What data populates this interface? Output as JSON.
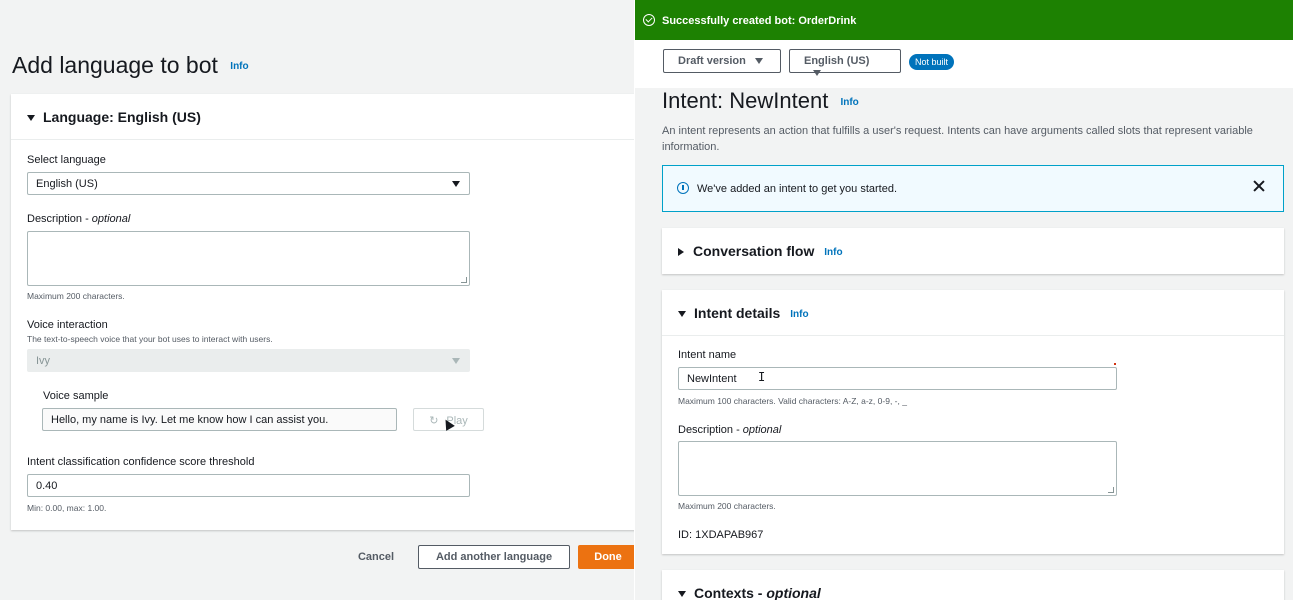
{
  "left": {
    "title": "Add language to bot",
    "title_info": "Info",
    "card_header": "Language: English (US)",
    "select_language_label": "Select language",
    "select_language_value": "English (US)",
    "description_label": "Description - ",
    "description_optional": "optional",
    "description_hint": "Maximum 200 characters.",
    "voice_label": "Voice interaction",
    "voice_hint": "The text-to-speech voice that your bot uses to interact with users.",
    "voice_value": "Ivy",
    "voice_sample_label": "Voice sample",
    "voice_sample_value": "Hello, my name is Ivy. Let me know how I can assist you.",
    "play_label": "Play",
    "threshold_label": "Intent classification confidence score threshold",
    "threshold_value": "0.40",
    "threshold_hint": "Min: 0.00, max: 1.00.",
    "cancel": "Cancel",
    "add_another": "Add another language",
    "done": "Done"
  },
  "right": {
    "flash": "Successfully created bot: OrderDrink",
    "version_dropdown": "Draft version",
    "language_dropdown": "English (US)",
    "status_badge": "Not built",
    "title": "Intent: NewIntent",
    "title_info": "Info",
    "description": "An intent represents an action that fulfills a user's request. Intents can have arguments called slots that represent variable information.",
    "alert": "We've added an intent to get you started.",
    "conversation_flow": "Conversation flow",
    "conversation_info": "Info",
    "intent_details": "Intent details",
    "intent_details_info": "Info",
    "intent_name_label": "Intent name",
    "intent_name_value": "NewIntent",
    "intent_name_hint": "Maximum 100 characters. Valid characters: A-Z, a-z, 0-9, -, _",
    "description_label": "Description - ",
    "description_optional": "optional",
    "description_hint": "Maximum 200 characters.",
    "id_text": "ID: 1XDAPAB967",
    "contexts": "Contexts - ",
    "contexts_optional": "optional"
  },
  "colors": {
    "success": "#1d8102",
    "primary": "#ec7211",
    "link": "#0073bb"
  }
}
